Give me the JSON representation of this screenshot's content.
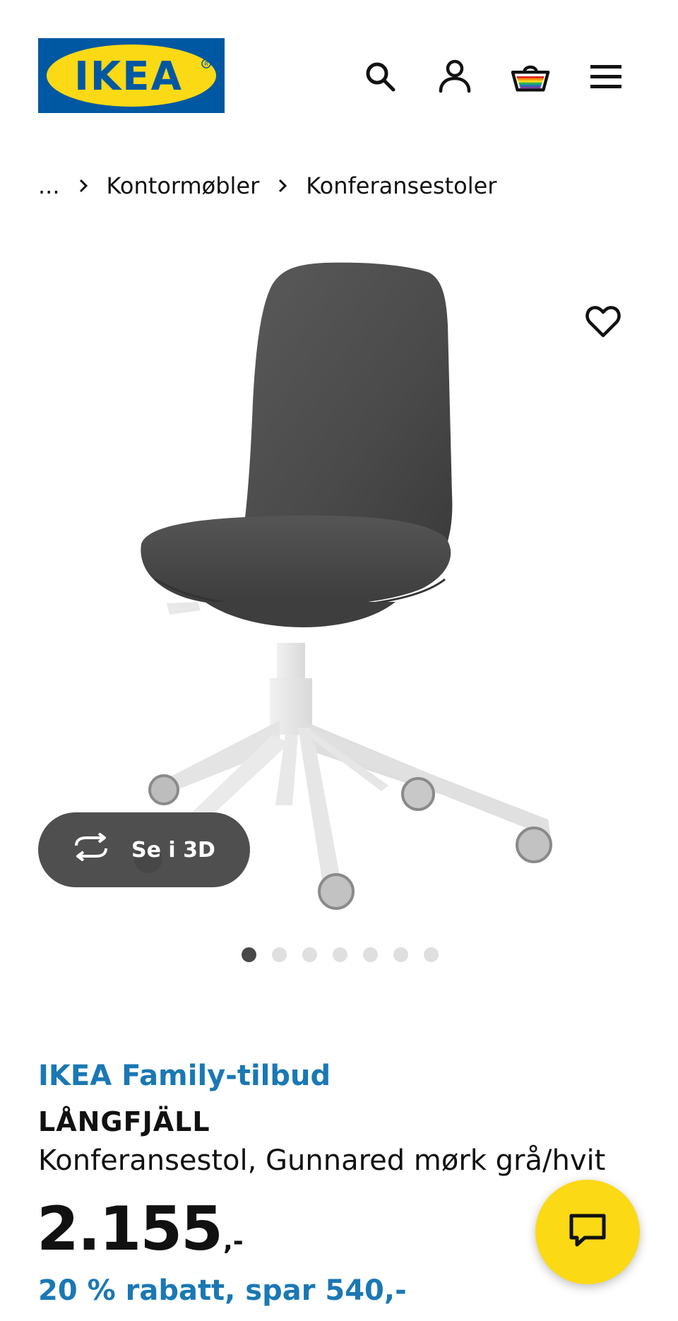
{
  "brand": {
    "logo_text": "IKEA",
    "logo_blue": "#0058a3",
    "logo_yellow": "#fbd914"
  },
  "header": {
    "icons": [
      "search-icon",
      "profile-icon",
      "shopping-basket-icon",
      "menu-icon"
    ]
  },
  "breadcrumb": {
    "ellipsis": "...",
    "items": [
      "Kontormøbler",
      "Konferansestoler"
    ]
  },
  "gallery": {
    "view_3d_label": "Se i 3D",
    "image_count": 7,
    "active_index": 0
  },
  "product": {
    "offer_label": "IKEA Family-tilbud",
    "name": "LÅNGFJÄLL",
    "description": "Konferansestol, Gunnared mørk grå/hvit",
    "price": "2.155",
    "price_suffix": ",-",
    "discount": "20 % rabatt, spar 540,-"
  },
  "colors": {
    "accent_blue": "#1a78b4",
    "chat_yellow": "#fbd914",
    "button_dark": "#484848"
  }
}
